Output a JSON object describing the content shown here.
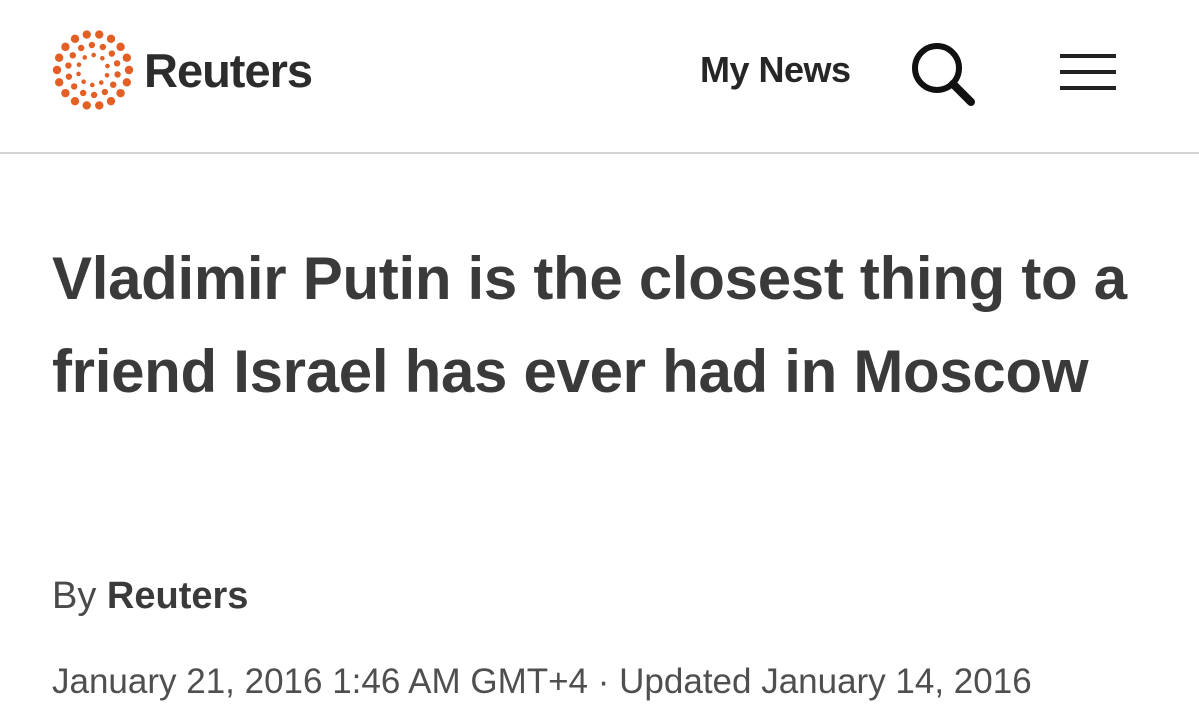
{
  "header": {
    "brand": "Reuters",
    "brand_color": "#e35f26",
    "nav_label": "My News",
    "search_icon": "search-icon",
    "menu_icon": "hamburger-menu-icon"
  },
  "article": {
    "headline": "Vladimir Putin is the closest thing to a friend Israel has ever had in Moscow",
    "byline_prefix": "By",
    "author": "Reuters",
    "published": "January 21, 2016 1:46 AM GMT+4",
    "separator": "·",
    "updated": "Updated January 14, 2016"
  }
}
